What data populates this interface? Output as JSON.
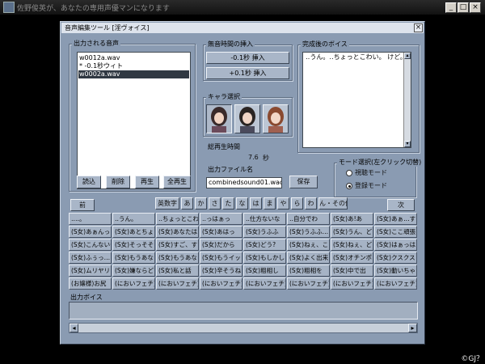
{
  "outer_window": {
    "title": "佐野俊英が、あなたの専用声優マンになります",
    "min": "_",
    "max": "□",
    "close": "×"
  },
  "dialog": {
    "title": "音声編集ツール [淫ヴォイス]",
    "close": "×"
  },
  "output_audio": {
    "label": "出力される音声",
    "items": [
      {
        "text": "w0012a.wav",
        "selected": false
      },
      {
        "text": "* -0.1秒ウィト",
        "selected": false
      },
      {
        "text": "w0002a.wav",
        "selected": true
      }
    ],
    "buttons": {
      "read": "読込",
      "delete": "削除",
      "play": "再生",
      "play_all": "全再生"
    }
  },
  "silence": {
    "label": "無音時間の挿入",
    "minus_button": "-0.1秒 挿入",
    "plus_button": "+0.1秒 挿入"
  },
  "character": {
    "label": "キャラ選択",
    "selected_index": 0
  },
  "completed_voice": {
    "label": "完成後のボイス",
    "text": "‥うん。‥ちょっとこわい。 けど。"
  },
  "total_time": {
    "label": "総再生時間",
    "value": "7.6",
    "unit": "秒"
  },
  "output_file": {
    "label": "出力ファイル名",
    "value": "combinedsound01.wao",
    "save_button": "保存"
  },
  "mode": {
    "label": "モード選択(左クリック切替)",
    "listen": "視聴モード",
    "register": "登録モード",
    "selected": "register"
  },
  "nav": {
    "prev": "前",
    "next": "次",
    "kana_tabs": [
      "英数字",
      "あ",
      "か",
      "さ",
      "た",
      "な",
      "は",
      "ま",
      "や",
      "ら",
      "わ",
      "ん・その他"
    ]
  },
  "phrase_grid": [
    [
      "‥‥。",
      "‥うん。",
      "‥ちょっとこわい",
      "‥っはぁっ",
      "‥仕方ないな",
      "‥自分でわ",
      "(S女)あ!あ",
      "(S女)あぁ…すご"
    ],
    [
      "(S女)あぁんっ",
      "(S女)あとちょ",
      "(S女)あなたは",
      "(S女)あはっ",
      "(S女)うふふ",
      "(S女)うふふ…",
      "(S女)うん、ど",
      "(S女)ここ頑張"
    ],
    [
      "(S女)こんないや",
      "(S女)そっそそ",
      "(S女)すご、す",
      "(S女)だから",
      "(S女)どう?",
      "(S女)ねぇ、こ",
      "(S女)ねぇ、ど",
      "(S女)はぁっはぁ"
    ],
    [
      "(S女)ふぅっ…",
      "(S女)もうあな",
      "(S女)もうあな",
      "(S女)もうイッ",
      "(S女)もしかし",
      "(S女)よく出来",
      "(S女)オチンポ",
      "(S女)クスクス"
    ],
    [
      "(S女)ムリヤリ",
      "(S女)嫌ならど",
      "(S女)私と話",
      "(S女)辛そうね",
      "(S女)粗相し",
      "(S女)粗相を",
      "(S女)中で出",
      "(S女)動いちゃ"
    ],
    [
      "(お嬢様)お尻",
      "(においフェチ)",
      "(においフェチ)",
      "(においフェチ)",
      "(においフェチ)",
      "(においフェチ)",
      "(においフェチ)",
      "(においフェチ)"
    ]
  ],
  "output_voice": {
    "label": "出力ボイス",
    "value": ""
  },
  "scroll": {
    "left": "◂",
    "right": "▸",
    "up": "▴",
    "down": "▾"
  },
  "footer": {
    "text": "©GJ？"
  },
  "colors": {
    "dialog_bg": "#8a9bb2",
    "cell_bg": "#a6b3c5",
    "selected": "#303842"
  }
}
